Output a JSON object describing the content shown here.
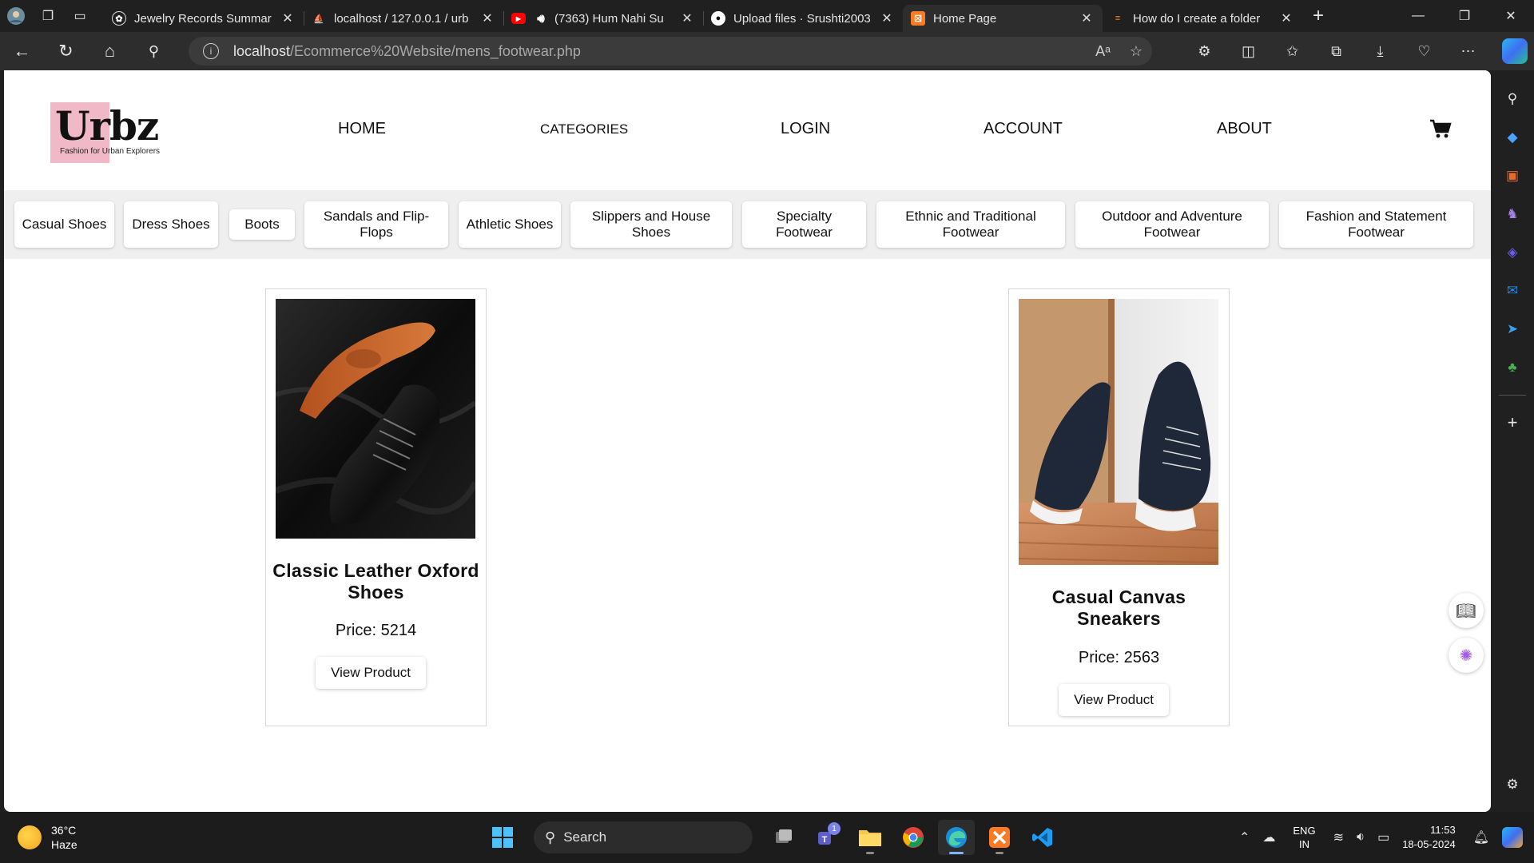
{
  "browser": {
    "tabs": [
      {
        "title": "Jewelry Records Summar",
        "icon": "chatgpt-icon",
        "active": false
      },
      {
        "title": "localhost / 127.0.0.1 / urb",
        "icon": "phpmyadmin-icon",
        "active": false
      },
      {
        "title": "(7363) Hum Nahi Su",
        "icon": "youtube-icon",
        "active": false
      },
      {
        "title": "Upload files · Srushti2003",
        "icon": "github-icon",
        "active": false
      },
      {
        "title": "Home Page",
        "icon": "xampp-icon",
        "active": true
      },
      {
        "title": "How do I create a folder",
        "icon": "stackoverflow-icon",
        "active": false
      }
    ],
    "url_host": "localhost",
    "url_path": "/Ecommerce%20Website/mens_footwear.php"
  },
  "site": {
    "logo_text": "Urbz",
    "logo_tagline": "Fashion for Urban Explorers",
    "nav": {
      "home": "HOME",
      "categories": "CATEGORIES",
      "login": "LOGIN",
      "account": "ACCOUNT",
      "about": "ABOUT"
    },
    "categories": [
      "Casual Shoes",
      "Dress Shoes",
      "Boots",
      "Sandals and Flip-Flops",
      "Athletic Shoes",
      "Slippers and House Shoes",
      "Specialty Footwear",
      "Ethnic and Traditional Footwear",
      "Outdoor and Adventure Footwear",
      "Fashion and Statement Footwear"
    ],
    "products": [
      {
        "name": "Classic Leather Oxford Shoes",
        "price_label": "Price: 5214",
        "button": "View Product"
      },
      {
        "name": "Casual Canvas Sneakers",
        "price_label": "Price: 2563",
        "button": "View Product"
      }
    ],
    "colors": {
      "logo_accent": "#f1b8c8",
      "category_bar": "#efefef"
    }
  },
  "taskbar": {
    "weather_temp": "36°C",
    "weather_desc": "Haze",
    "search_label": "Search",
    "lang_top": "ENG",
    "lang_bottom": "IN",
    "time": "11:53",
    "date": "18-05-2024",
    "teams_badge": "1"
  }
}
